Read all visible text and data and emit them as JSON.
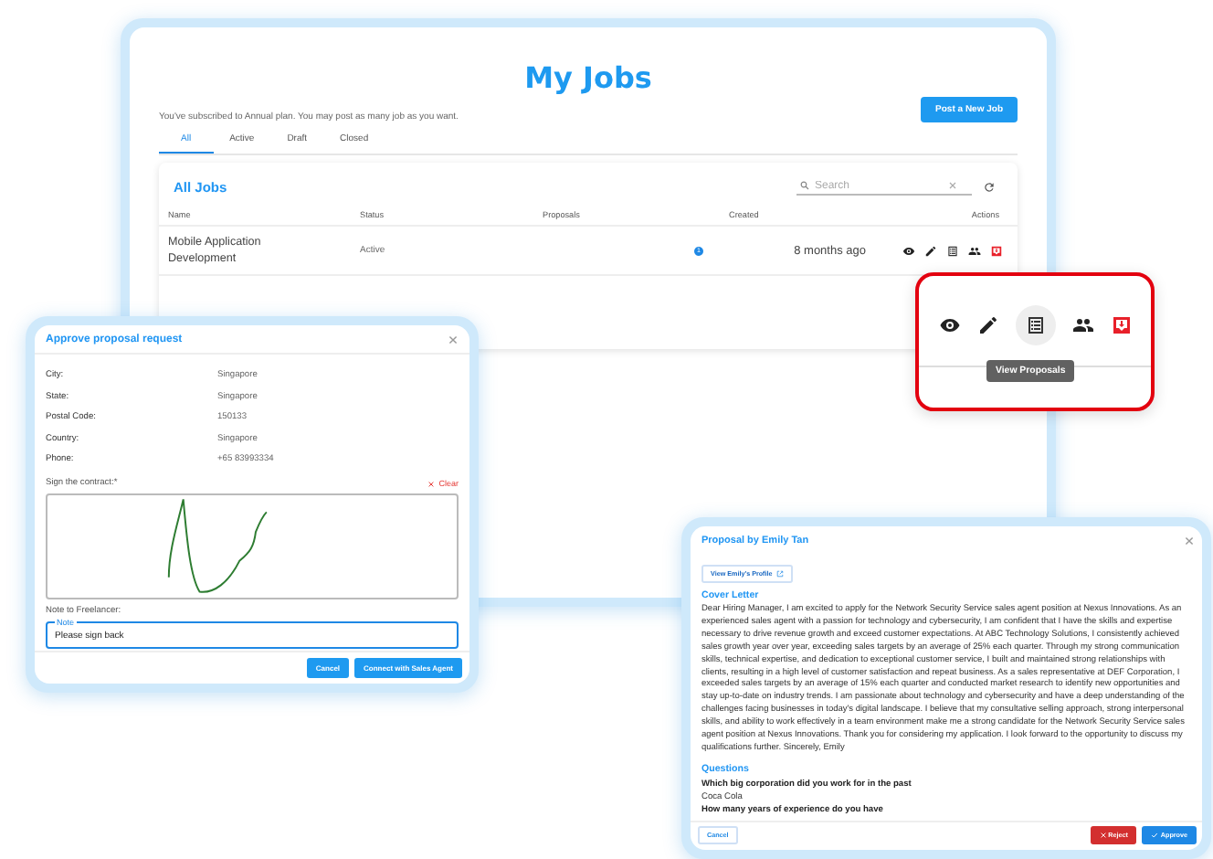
{
  "jobs_page": {
    "title": "My Jobs",
    "subscription_note": "You've subscribed to Annual plan. You may post as many job as you want.",
    "post_button": "Post a New Job",
    "tabs": [
      {
        "label": "All",
        "selected": true
      },
      {
        "label": "Active",
        "selected": false
      },
      {
        "label": "Draft",
        "selected": false
      },
      {
        "label": "Closed",
        "selected": false
      }
    ],
    "card": {
      "title": "All Jobs",
      "search": {
        "placeholder": "Search"
      },
      "columns": [
        "Name",
        "Status",
        "Proposals",
        "Created",
        "Actions"
      ],
      "rows": [
        {
          "name": "Mobile Application Development",
          "status": "Active",
          "proposals": "1",
          "created": "8 months ago"
        }
      ]
    }
  },
  "zoom_callout": {
    "tooltip": "View Proposals"
  },
  "approve_dialog": {
    "title": "Approve proposal request",
    "details": [
      {
        "label": "City:",
        "value": "Singapore"
      },
      {
        "label": "State:",
        "value": "Singapore"
      },
      {
        "label": "Postal Code:",
        "value": "150133"
      },
      {
        "label": "Country:",
        "value": "Singapore"
      },
      {
        "label": "Phone:",
        "value": "+65 83993334"
      }
    ],
    "signature_label": "Sign the contract:*",
    "clear": "Clear",
    "note_label": "Note to Freelancer:",
    "note_field": {
      "label": "Note",
      "value": "Please sign back"
    },
    "buttons": [
      "Cancel",
      "Connect with Sales Agent"
    ]
  },
  "proposal_dialog": {
    "title": "Proposal by Emily Tan",
    "profile_button": "View Emily's Profile",
    "cover_letter_heading": "Cover Letter",
    "cover_letter": "Dear Hiring Manager, I am excited to apply for the Network Security Service sales agent position at Nexus Innovations. As an experienced sales agent with a passion for technology and cybersecurity, I am confident that I have the skills and expertise necessary to drive revenue growth and exceed customer expectations. At ABC Technology Solutions, I consistently achieved sales growth year over year, exceeding sales targets by an average of 25% each quarter. Through my strong communication skills, technical expertise, and dedication to exceptional customer service, I built and maintained strong relationships with clients, resulting in a high level of customer satisfaction and repeat business. As a sales representative at DEF Corporation, I exceeded sales targets by an average of 15% each quarter and conducted market research to identify new opportunities and stay up-to-date on industry trends. I am passionate about technology and cybersecurity and have a deep understanding of the challenges facing businesses in today's digital landscape. I believe that my consultative selling approach, strong interpersonal skills, and ability to work effectively in a team environment make me a strong candidate for the Network Security Service sales agent position at Nexus Innovations. Thank you for considering my application. I look forward to the opportunity to discuss my qualifications further. Sincerely, Emily",
    "questions_heading": "Questions",
    "questions": [
      {
        "question": "Which big corporation did you work for in the past",
        "answer": "Coca Cola"
      },
      {
        "question": "How many years of experience do you have"
      }
    ],
    "buttons": [
      {
        "label": "Cancel",
        "kind": "outline"
      },
      {
        "label": "Reject",
        "kind": "reject"
      },
      {
        "label": "Approve",
        "kind": "approve"
      }
    ]
  }
}
